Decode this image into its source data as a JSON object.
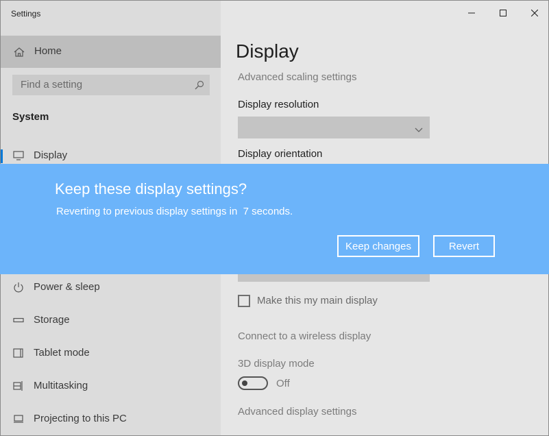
{
  "window": {
    "title": "Settings"
  },
  "sidebar": {
    "home_label": "Home",
    "search_placeholder": "Find a setting",
    "section_title": "System",
    "items": [
      {
        "label": "Display",
        "icon": "monitor-icon"
      },
      {
        "label": "Power & sleep",
        "icon": "power-icon"
      },
      {
        "label": "Storage",
        "icon": "storage-icon"
      },
      {
        "label": "Tablet mode",
        "icon": "tablet-icon"
      },
      {
        "label": "Multitasking",
        "icon": "multitasking-icon"
      },
      {
        "label": "Projecting to this PC",
        "icon": "projector-icon"
      }
    ]
  },
  "main": {
    "title": "Display",
    "advanced_scaling_link": "Advanced scaling settings",
    "resolution_label": "Display resolution",
    "resolution_value": "",
    "orientation_label": "Display orientation",
    "main_display_label": "Make this my main display",
    "main_display_checked": false,
    "wireless_link": "Connect to a wireless display",
    "mode_3d_label": "3D display mode",
    "mode_3d_state": "Off",
    "advanced_display_link": "Advanced display settings"
  },
  "dialog": {
    "title": "Keep these display settings?",
    "message": "Reverting to previous display settings in  7 seconds.",
    "keep_button": "Keep changes",
    "revert_button": "Revert"
  },
  "colors": {
    "dialog_background": "#6cb4fa",
    "accent": "#0078d7"
  }
}
